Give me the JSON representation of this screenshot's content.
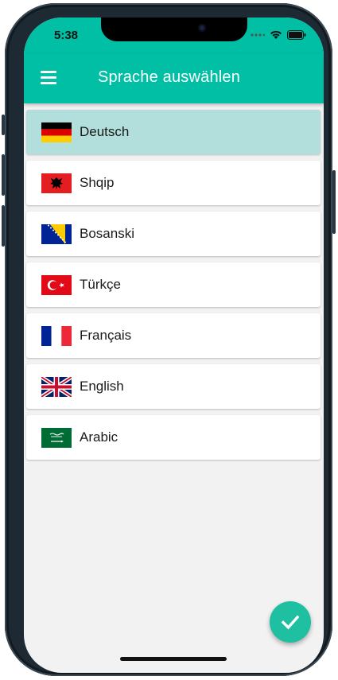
{
  "status_bar": {
    "time": "5:38",
    "icons": [
      "signal-dots-icon",
      "wifi-icon",
      "battery-icon"
    ]
  },
  "app_bar": {
    "title": "Sprache auswählen",
    "menu_icon": "hamburger-menu-icon"
  },
  "languages": [
    {
      "label": "Deutsch",
      "flag": "germany-flag-icon",
      "selected": true
    },
    {
      "label": "Shqip",
      "flag": "albania-flag-icon",
      "selected": false
    },
    {
      "label": "Bosanski",
      "flag": "bosnia-flag-icon",
      "selected": false
    },
    {
      "label": "Türkçe",
      "flag": "turkey-flag-icon",
      "selected": false
    },
    {
      "label": "Français",
      "flag": "france-flag-icon",
      "selected": false
    },
    {
      "label": "English",
      "flag": "uk-flag-icon",
      "selected": false
    },
    {
      "label": "Arabic",
      "flag": "saudi-arabia-flag-icon",
      "selected": false
    }
  ],
  "fab": {
    "icon": "checkmark-icon"
  },
  "colors": {
    "accent": "#00bfa5",
    "selected_row": "#b2dfdb",
    "background": "#f2f2f2"
  }
}
